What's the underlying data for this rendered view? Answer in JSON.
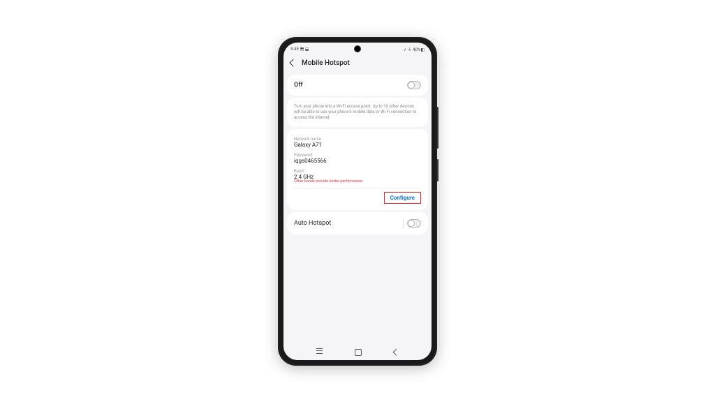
{
  "status": {
    "time": "5:45",
    "indicators": "⬒ ⬓",
    "right": "⸙ ⏚ 40%◧"
  },
  "header": {
    "title": "Mobile Hotspot"
  },
  "main_toggle": {
    "label": "Off",
    "description": "Turn your phone into a Wi-Fi access point. Up to 10 other devices will be able to use your phone's mobile data or Wi-Fi connection to access the internet."
  },
  "network": {
    "name_label": "Network name",
    "name_value": "Galaxy A71",
    "password_label": "Password",
    "password_value": "iqgs0465566",
    "band_label": "Band",
    "band_value": "2.4 GHz",
    "band_warning": "Other bands provide better performance.",
    "configure": "Configure"
  },
  "auto": {
    "label": "Auto Hotspot"
  }
}
